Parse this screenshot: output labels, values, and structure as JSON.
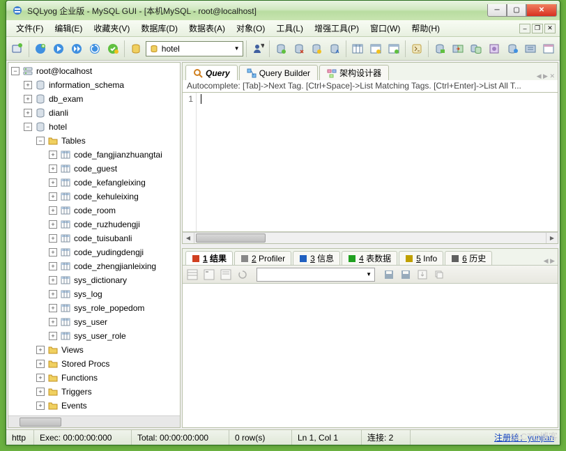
{
  "title": "SQLyog 企业版 - MySQL GUI - [本机MySQL - root@localhost]",
  "menus": [
    "文件(F)",
    "编辑(E)",
    "收藏夹(V)",
    "数据库(D)",
    "数据表(A)",
    "对象(O)",
    "工具(L)",
    "增强工具(P)",
    "窗口(W)",
    "帮助(H)"
  ],
  "db_selected": "hotel",
  "tree": {
    "root": "root@localhost",
    "dbs": [
      {
        "name": "information_schema",
        "expanded": false
      },
      {
        "name": "db_exam",
        "expanded": false
      },
      {
        "name": "dianli",
        "expanded": false
      },
      {
        "name": "hotel",
        "expanded": true
      }
    ],
    "hotel_folders": [
      "Tables",
      "Views",
      "Stored Procs",
      "Functions",
      "Triggers",
      "Events"
    ],
    "hotel_tables": [
      "code_fangjianzhuangtai",
      "code_guest",
      "code_kefangleixing",
      "code_kehuleixing",
      "code_room",
      "code_ruzhudengji",
      "code_tuisubanli",
      "code_yudingdengji",
      "code_zhengjianleixing",
      "sys_dictionary",
      "sys_log",
      "sys_role_popedom",
      "sys_user",
      "sys_user_role"
    ]
  },
  "tabs": {
    "items": [
      {
        "label": "Query",
        "icon": "query-icon",
        "active": true
      },
      {
        "label": "Query Builder",
        "icon": "builder-icon",
        "active": false
      },
      {
        "label": "架构设计器",
        "icon": "schema-icon",
        "active": false
      }
    ]
  },
  "autocomplete_hint": "Autocomplete: [Tab]->Next Tag. [Ctrl+Space]->List Matching Tags. [Ctrl+Enter]->List All T...",
  "editor": {
    "line_no": "1"
  },
  "result_tabs": [
    {
      "num": "1",
      "label": "结果",
      "active": true,
      "color": "#d04020"
    },
    {
      "num": "2",
      "label": "Profiler",
      "active": false,
      "color": "#888"
    },
    {
      "num": "3",
      "label": "信息",
      "active": false,
      "color": "#2060c0"
    },
    {
      "num": "4",
      "label": "表数据",
      "active": false,
      "color": "#20a020"
    },
    {
      "num": "5",
      "label": "Info",
      "active": false,
      "color": "#c0a000"
    },
    {
      "num": "6",
      "label": "历史",
      "active": false,
      "color": "#606060"
    }
  ],
  "status": {
    "http": "http",
    "exec": "Exec: 00:00:00:000",
    "total": "Total: 00:00:00:000",
    "rows": "0 row(s)",
    "pos": "Ln 1, Col 1",
    "conn": "连接: 2",
    "reg": "注册给：yunjian"
  },
  "watermark": "51CTO博客"
}
